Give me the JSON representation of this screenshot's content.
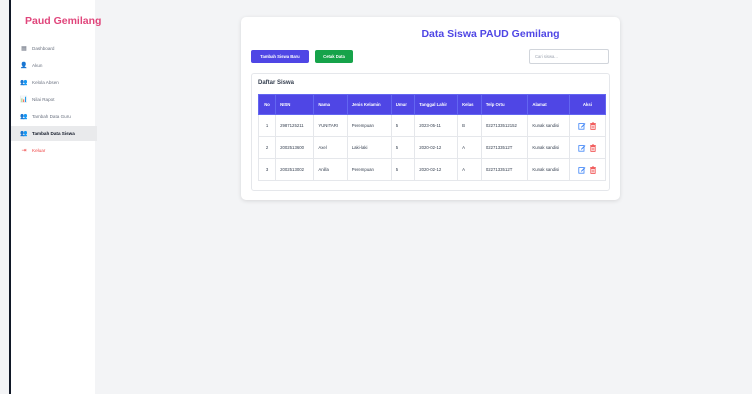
{
  "sidebar": {
    "brand": "Paud Gemilang",
    "items": [
      {
        "label": "Dashboard",
        "icon": "grid-icon",
        "glyph": "▦",
        "active": false
      },
      {
        "label": "Akun",
        "icon": "user-icon",
        "glyph": "👤",
        "active": false
      },
      {
        "label": "Kelola Absen",
        "icon": "users-icon",
        "glyph": "👥",
        "active": false
      },
      {
        "label": "Nilai Rapot",
        "icon": "bar-chart-icon",
        "glyph": "📊",
        "active": false
      },
      {
        "label": "Tambah Data Guru",
        "icon": "user-plus-icon",
        "glyph": "👥",
        "active": false
      },
      {
        "label": "Tambah Data Siswa",
        "icon": "user-plus-icon",
        "glyph": "👥",
        "active": true
      },
      {
        "label": "Keluar",
        "icon": "logout-icon",
        "glyph": "⇥",
        "active": false
      }
    ]
  },
  "main": {
    "title": "Data Siswa PAUD Gemilang",
    "add_button": "Tambah Siswa Baru",
    "print_button": "Cetak Data",
    "search_placeholder": "Cari siswa...",
    "list_title": "Daftar Siswa"
  },
  "table": {
    "headers": [
      "No",
      "NISN",
      "Nama",
      "Jenis Kelamin",
      "Umur",
      "Tanggal Lahir",
      "Kelas",
      "Telp Ortu",
      "Alamat",
      "Aksi"
    ],
    "rows": [
      [
        "1",
        "2987125211",
        "YUNITARI",
        "Perempuan",
        "5",
        "2023-05-11",
        "B",
        "0227133512152",
        "Kunak sandisi"
      ],
      [
        "2",
        "2002513600",
        "Axel",
        "Laki-laki",
        "5",
        "2020-02-12",
        "A",
        "0227133512T",
        "Kunak sandisi"
      ],
      [
        "3",
        "2002513002",
        "Anilla",
        "Perempuan",
        "5",
        "2020-02-12",
        "A",
        "0227133512T",
        "Kunak sandisi"
      ]
    ]
  },
  "colors": {
    "accent": "#4f46e5",
    "brand": "#e0457b",
    "success": "#16a34a",
    "danger": "#ef4444",
    "edit": "#3b82f6"
  }
}
